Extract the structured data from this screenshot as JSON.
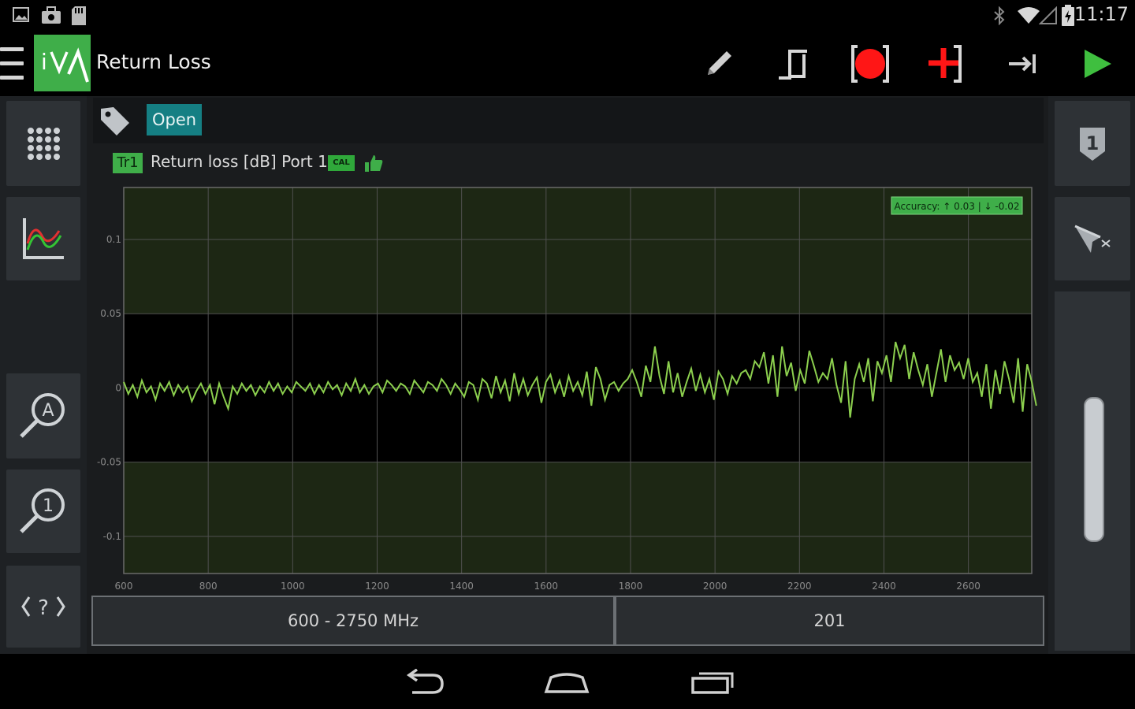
{
  "status_bar": {
    "time": "11:17",
    "left_icons": [
      "gallery-icon",
      "briefcase-icon",
      "sd-card-icon"
    ],
    "right_icons": [
      "bluetooth-icon",
      "wifi-icon",
      "signal-icon",
      "battery-icon"
    ]
  },
  "action_bar": {
    "logo_text": "iVN",
    "title": "Return Loss",
    "actions": [
      "pencil-icon",
      "pulse-icon",
      "record-icon",
      "add-marker-icon",
      "step-forward-icon",
      "play-icon"
    ]
  },
  "tag_bar": {
    "chip": "Open"
  },
  "trace": {
    "badge": "Tr1",
    "description": "Return loss  [dB]  Port 1",
    "cal_badge": "CAL",
    "color": "#8ccf4e"
  },
  "chart_data": {
    "type": "line",
    "x_unit": "MHz",
    "xlim": [
      600,
      2750
    ],
    "ylim": [
      -0.125,
      0.135
    ],
    "x_ticks": [
      600,
      800,
      1000,
      1200,
      1400,
      1600,
      1800,
      2000,
      2200,
      2400,
      2600
    ],
    "x_tick_labels": [
      "600",
      "800",
      "1000",
      "1200",
      "1400",
      "1600",
      "1800",
      "2000",
      "2200",
      "2400",
      "2600"
    ],
    "y_ticks": [
      0.1,
      0.05,
      0,
      -0.05,
      -0.1
    ],
    "y_tick_labels": [
      "0.1",
      "0.05",
      "0",
      "-0.05",
      "-0.1"
    ],
    "accuracy_label": "Accuracy: ↑ 0.03 | ↓ -0.02",
    "accuracy_band": [
      -0.05,
      0.05
    ],
    "colors": {
      "band": "#1d2714",
      "outside": "#1d2714",
      "inside": "#000000",
      "grid": "#505050",
      "trace": "#8ccf4e",
      "badge": "#3fae49"
    },
    "points": 201,
    "series": [
      {
        "x_start": 600,
        "x_step": 10.75,
        "values": [
          0.004,
          -0.004,
          0.002,
          -0.006,
          0.005,
          -0.003,
          0.001,
          -0.008,
          0.003,
          -0.002,
          0.004,
          -0.005,
          0.002,
          -0.003,
          0.001,
          -0.009,
          -0.002,
          0.003,
          -0.004,
          0.002,
          -0.011,
          0.003,
          -0.006,
          -0.014,
          0.001,
          -0.004,
          0.003,
          -0.002,
          0.002,
          -0.005,
          0.001,
          -0.003,
          0.004,
          -0.002,
          0.003,
          -0.004,
          0.001,
          -0.003,
          0.004,
          0.001,
          -0.002,
          0.003,
          -0.004,
          0.002,
          -0.003,
          0.004,
          -0.001,
          0.002,
          -0.005,
          0.003,
          -0.002,
          0.006,
          -0.003,
          0.002,
          -0.004,
          0.001,
          0.003,
          -0.003,
          0.005,
          0.002,
          -0.002,
          0.003,
          0.001,
          -0.004,
          0.005,
          0.001,
          -0.003,
          0.004,
          0.002,
          -0.002,
          0.006,
          0.002,
          -0.004,
          0.003,
          -0.001,
          -0.006,
          0.004,
          0.002,
          -0.008,
          0.006,
          0.003,
          -0.007,
          0.008,
          -0.003,
          0.005,
          -0.009,
          0.01,
          -0.004,
          0.006,
          -0.005,
          0.002,
          0.007,
          -0.01,
          0.004,
          0.009,
          -0.003,
          0.005,
          -0.006,
          0.008,
          -0.002,
          0.004,
          -0.005,
          0.011,
          -0.012,
          0.014,
          0.006,
          -0.008,
          0.002,
          0.004,
          -0.002,
          0.003,
          0.006,
          0.012,
          0.004,
          -0.006,
          0.015,
          0.004,
          0.028,
          0.008,
          -0.004,
          0.018,
          -0.003,
          0.01,
          -0.006,
          0.004,
          0.013,
          -0.002,
          0.009,
          -0.003,
          0.006,
          -0.008,
          0.011,
          0.006,
          -0.004,
          0.008,
          0.003,
          0.01,
          0.012,
          0.006,
          0.018,
          0.014,
          0.024,
          0.003,
          0.022,
          -0.006,
          0.028,
          0.008,
          0.017,
          -0.002,
          0.012,
          0.003,
          0.025,
          0.015,
          0.004,
          0.01,
          0.006,
          0.02,
          0.002,
          -0.01,
          0.018,
          -0.02,
          0.006,
          0.016,
          0.004,
          0.02,
          -0.009,
          0.018,
          0.01,
          0.022,
          0.004,
          0.031,
          0.02,
          0.029,
          0.006,
          0.024,
          0.012,
          0.002,
          0.016,
          -0.006,
          0.01,
          0.026,
          0.004,
          0.022,
          0.012,
          0.017,
          0.006,
          0.02,
          0.004,
          0.01,
          -0.006,
          0.016,
          -0.014,
          0.012,
          -0.004,
          0.018,
          0.006,
          -0.01,
          0.02,
          -0.016,
          0.016,
          0.004,
          -0.012
        ]
      }
    ]
  },
  "fields": {
    "frequency_range": "600 -  2750  MHz",
    "points": "201"
  },
  "left_toolbar": [
    "keypad-icon",
    "trace-chart-icon",
    "autoscale-zoom-icon",
    "marker-zoom-icon",
    "help-code-icon"
  ],
  "right_toolbar": [
    "port-1-badge-icon",
    "marker-move-icon",
    "scroll-slider"
  ]
}
